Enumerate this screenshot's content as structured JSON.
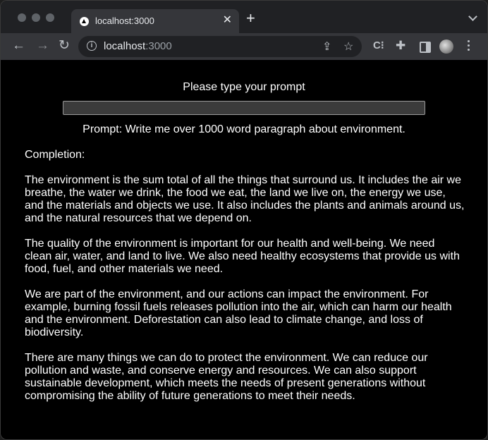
{
  "browser": {
    "tab_title": "localhost:3000",
    "tab_close_icon": "close-icon",
    "new_tab_icon": "plus-icon",
    "url_host": "localhost",
    "url_port": ":3000"
  },
  "page": {
    "prompt_label": "Please type your prompt",
    "prompt_input_value": "",
    "prompt_echo": "Prompt: Write me over 1000 word paragraph about environment.",
    "completion_label": "Completion:",
    "paragraphs": [
      "The environment is the sum total of all the things that surround us. It includes the air we breathe, the water we drink, the food we eat, the land we live on, the energy we use, and the materials and objects we use. It also includes the plants and animals around us, and the natural resources that we depend on.",
      "The quality of the environment is important for our health and well-being. We need clean air, water, and land to live. We also need healthy ecosystems that provide us with food, fuel, and other materials we need.",
      "We are part of the environment, and our actions can impact the environment. For example, burning fossil fuels releases pollution into the air, which can harm our health and the environment. Deforestation can also lead to climate change, and loss of biodiversity.",
      "There are many things we can do to protect the environment. We can reduce our pollution and waste, and conserve energy and resources. We can also support sustainable development, which meets the needs of present generations without compromising the ability of future generations to meet their needs."
    ]
  }
}
